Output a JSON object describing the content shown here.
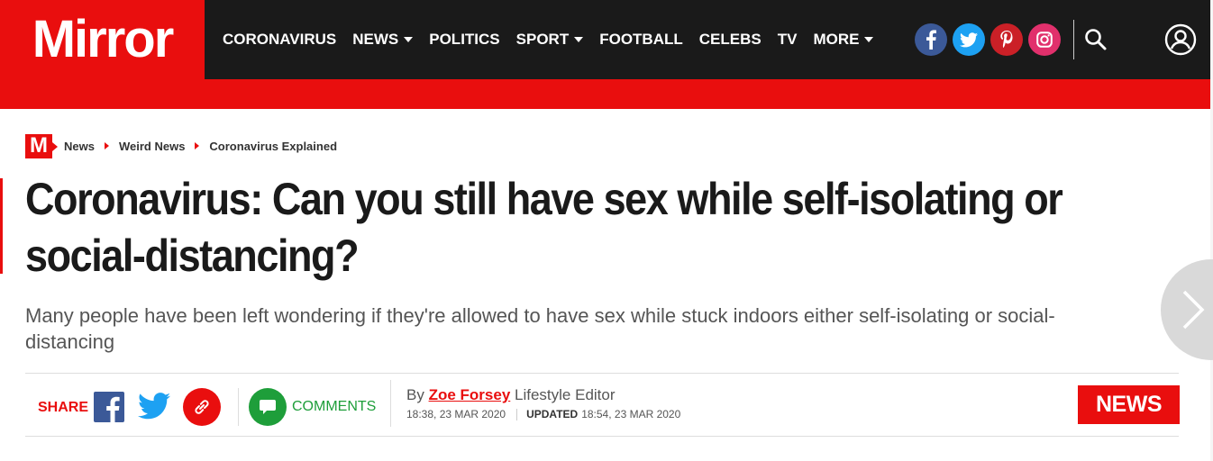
{
  "header": {
    "logo_text": "Mirror",
    "nav": [
      {
        "label": "CORONAVIRUS",
        "dropdown": false
      },
      {
        "label": "NEWS",
        "dropdown": true
      },
      {
        "label": "POLITICS",
        "dropdown": false
      },
      {
        "label": "SPORT",
        "dropdown": true
      },
      {
        "label": "FOOTBALL",
        "dropdown": false
      },
      {
        "label": "CELEBS",
        "dropdown": false
      },
      {
        "label": "TV",
        "dropdown": false
      },
      {
        "label": "MORE",
        "dropdown": true
      }
    ],
    "socials": [
      {
        "name": "facebook-icon",
        "color": "#3b5998"
      },
      {
        "name": "twitter-icon",
        "color": "#1da1f2"
      },
      {
        "name": "pinterest-icon",
        "color": "#cb2027"
      },
      {
        "name": "instagram-icon",
        "color": "#e1306c"
      }
    ]
  },
  "breadcrumb": {
    "badge": "M",
    "items": [
      "News",
      "Weird News",
      "Coronavirus Explained"
    ]
  },
  "article": {
    "headline": "Coronavirus: Can you still have sex while self-isolating or social-distancing?",
    "standfirst": "Many people have been left wondering if they're allowed to have sex while stuck indoors either self-isolating or social-distancing"
  },
  "share": {
    "label": "SHARE",
    "comments_label": "COMMENTS"
  },
  "byline": {
    "by": "By",
    "author": "Zoe Forsey",
    "role": "Lifestyle Editor",
    "published": "18:38, 23 MAR 2020",
    "updated_label": "UPDATED",
    "updated": "18:54, 23 MAR 2020"
  },
  "section_badge": "NEWS",
  "colors": {
    "brand_red": "#e90e0e",
    "nav_bg": "#1a1a1a",
    "comments_green": "#1e9e3a"
  }
}
